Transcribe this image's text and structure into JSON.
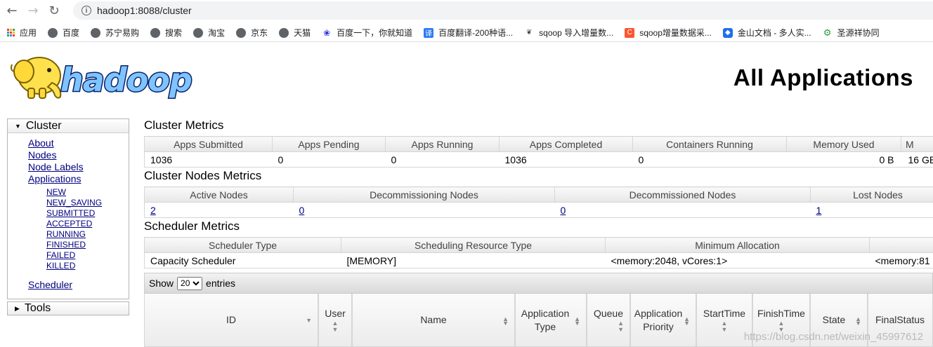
{
  "browser": {
    "url": "hadoop1:8088/cluster",
    "bookmarks": [
      "应用",
      "百度",
      "苏宁易购",
      "搜索",
      "淘宝",
      "京东",
      "天猫",
      "百度一下，你就知道",
      "百度翻译-200种语...",
      "sqoop 导入增量数...",
      "sqoop增量数据采...",
      "金山文档 - 多人实...",
      "圣源祥协同"
    ]
  },
  "header": {
    "title": "All Applications",
    "logo_text": "hadoop"
  },
  "sidebar": {
    "cluster_label": "Cluster",
    "links": [
      "About",
      "Nodes",
      "Node Labels",
      "Applications"
    ],
    "app_states": [
      "NEW",
      "NEW_SAVING",
      "SUBMITTED",
      "ACCEPTED",
      "RUNNING",
      "FINISHED",
      "FAILED",
      "KILLED"
    ],
    "scheduler": "Scheduler",
    "tools_label": "Tools"
  },
  "cluster_metrics": {
    "title": "Cluster Metrics",
    "headers": [
      "Apps Submitted",
      "Apps Pending",
      "Apps Running",
      "Apps Completed",
      "Containers Running",
      "Memory Used",
      "M"
    ],
    "values": [
      "1036",
      "0",
      "0",
      "1036",
      "0",
      "0 B",
      "16 GB"
    ]
  },
  "node_metrics": {
    "title": "Cluster Nodes Metrics",
    "headers": [
      "Active Nodes",
      "Decommissioning Nodes",
      "Decommissioned Nodes",
      "Lost Nodes"
    ],
    "values": [
      "2",
      "0",
      "0",
      "1"
    ]
  },
  "scheduler_metrics": {
    "title": "Scheduler Metrics",
    "headers": [
      "Scheduler Type",
      "Scheduling Resource Type",
      "Minimum Allocation",
      ""
    ],
    "values": [
      "Capacity Scheduler",
      "[MEMORY]",
      "<memory:2048, vCores:1>",
      "<memory:81"
    ]
  },
  "apps_table": {
    "show_label": "Show",
    "entries_label": "entries",
    "page_size": "20",
    "columns": [
      "ID",
      "User",
      "Name",
      "Application Type",
      "Queue",
      "Application Priority",
      "StartTime",
      "FinishTime",
      "State",
      "FinalStatus"
    ]
  },
  "watermark": "https://blog.csdn.net/weixin_45997612"
}
